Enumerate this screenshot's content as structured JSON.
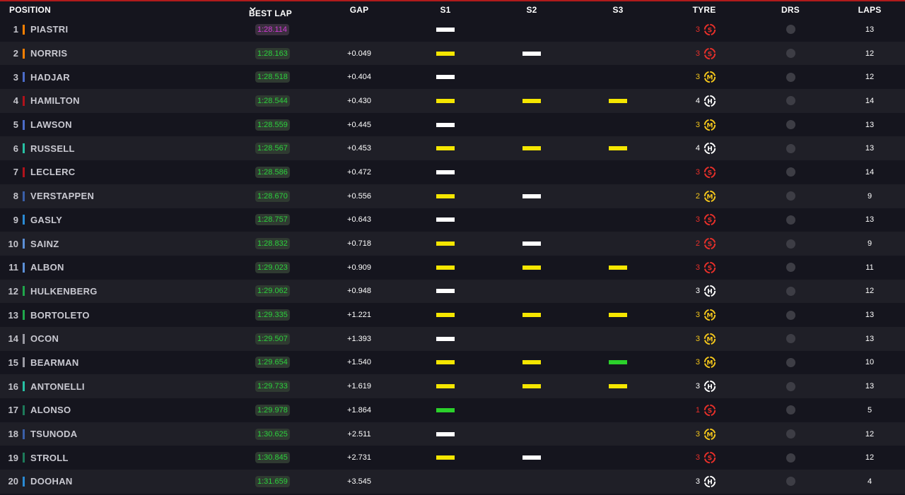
{
  "columns": {
    "position": "POSITION",
    "best_lap": "BEST LAP",
    "gap": "GAP",
    "s1": "S1",
    "s2": "S2",
    "s3": "S3",
    "tyre": "TYRE",
    "drs": "DRS",
    "laps": "LAPS"
  },
  "colors": {
    "white": "#ffffff",
    "yellow": "#f5e600",
    "green": "#2bd12b",
    "purple": "#d13bd6",
    "soft": "#e8302a",
    "medium": "#f4c61b",
    "hard": "#ffffff"
  },
  "tyre_letters": {
    "soft": "S",
    "medium": "M",
    "hard": "H"
  },
  "rows": [
    {
      "pos": "1",
      "driver": "PIASTRI",
      "team_color": "#ff8000",
      "best_lap": "1:28.114",
      "best_color": "purple",
      "gap": "",
      "s1": "white",
      "s2": "",
      "s3": "",
      "tyre": "soft",
      "tyre_age": "3",
      "laps": "13"
    },
    {
      "pos": "2",
      "driver": "NORRIS",
      "team_color": "#ff8000",
      "best_lap": "1:28.163",
      "best_color": "green",
      "gap": "+0.049",
      "s1": "yellow",
      "s2": "white",
      "s3": "",
      "tyre": "soft",
      "tyre_age": "3",
      "laps": "12"
    },
    {
      "pos": "3",
      "driver": "HADJAR",
      "team_color": "#4b6cc9",
      "best_lap": "1:28.518",
      "best_color": "green",
      "gap": "+0.404",
      "s1": "white",
      "s2": "",
      "s3": "",
      "tyre": "medium",
      "tyre_age": "3",
      "laps": "12"
    },
    {
      "pos": "4",
      "driver": "HAMILTON",
      "team_color": "#b0121b",
      "best_lap": "1:28.544",
      "best_color": "green",
      "gap": "+0.430",
      "s1": "yellow",
      "s2": "yellow",
      "s3": "yellow",
      "tyre": "hard",
      "tyre_age": "4",
      "laps": "14"
    },
    {
      "pos": "5",
      "driver": "LAWSON",
      "team_color": "#4b6cc9",
      "best_lap": "1:28.559",
      "best_color": "green",
      "gap": "+0.445",
      "s1": "white",
      "s2": "",
      "s3": "",
      "tyre": "medium",
      "tyre_age": "3",
      "laps": "13"
    },
    {
      "pos": "6",
      "driver": "RUSSELL",
      "team_color": "#27c1a4",
      "best_lap": "1:28.567",
      "best_color": "green",
      "gap": "+0.453",
      "s1": "yellow",
      "s2": "yellow",
      "s3": "yellow",
      "tyre": "hard",
      "tyre_age": "4",
      "laps": "13"
    },
    {
      "pos": "7",
      "driver": "LECLERC",
      "team_color": "#b0121b",
      "best_lap": "1:28.586",
      "best_color": "green",
      "gap": "+0.472",
      "s1": "white",
      "s2": "",
      "s3": "",
      "tyre": "soft",
      "tyre_age": "3",
      "laps": "14"
    },
    {
      "pos": "8",
      "driver": "VERSTAPPEN",
      "team_color": "#3a5fa8",
      "best_lap": "1:28.670",
      "best_color": "green",
      "gap": "+0.556",
      "s1": "yellow",
      "s2": "white",
      "s3": "",
      "tyre": "medium",
      "tyre_age": "2",
      "laps": "9"
    },
    {
      "pos": "9",
      "driver": "GASLY",
      "team_color": "#2a8ad4",
      "best_lap": "1:28.757",
      "best_color": "green",
      "gap": "+0.643",
      "s1": "white",
      "s2": "",
      "s3": "",
      "tyre": "soft",
      "tyre_age": "3",
      "laps": "13"
    },
    {
      "pos": "10",
      "driver": "SAINZ",
      "team_color": "#5b8fd6",
      "best_lap": "1:28.832",
      "best_color": "green",
      "gap": "+0.718",
      "s1": "yellow",
      "s2": "white",
      "s3": "",
      "tyre": "soft",
      "tyre_age": "2",
      "laps": "9"
    },
    {
      "pos": "11",
      "driver": "ALBON",
      "team_color": "#5b8fd6",
      "best_lap": "1:29.023",
      "best_color": "green",
      "gap": "+0.909",
      "s1": "yellow",
      "s2": "yellow",
      "s3": "yellow",
      "tyre": "soft",
      "tyre_age": "3",
      "laps": "11"
    },
    {
      "pos": "12",
      "driver": "HULKENBERG",
      "team_color": "#1fa74b",
      "best_lap": "1:29.062",
      "best_color": "green",
      "gap": "+0.948",
      "s1": "white",
      "s2": "",
      "s3": "",
      "tyre": "hard",
      "tyre_age": "3",
      "laps": "12"
    },
    {
      "pos": "13",
      "driver": "BORTOLETO",
      "team_color": "#1fa74b",
      "best_lap": "1:29.335",
      "best_color": "green",
      "gap": "+1.221",
      "s1": "yellow",
      "s2": "yellow",
      "s3": "yellow",
      "tyre": "medium",
      "tyre_age": "3",
      "laps": "13"
    },
    {
      "pos": "14",
      "driver": "OCON",
      "team_color": "#9a9aa3",
      "best_lap": "1:29.507",
      "best_color": "green",
      "gap": "+1.393",
      "s1": "white",
      "s2": "",
      "s3": "",
      "tyre": "medium",
      "tyre_age": "3",
      "laps": "13"
    },
    {
      "pos": "15",
      "driver": "BEARMAN",
      "team_color": "#9a9aa3",
      "best_lap": "1:29.654",
      "best_color": "green",
      "gap": "+1.540",
      "s1": "yellow",
      "s2": "yellow",
      "s3": "green",
      "tyre": "medium",
      "tyre_age": "3",
      "laps": "10"
    },
    {
      "pos": "16",
      "driver": "ANTONELLI",
      "team_color": "#27c1a4",
      "best_lap": "1:29.733",
      "best_color": "green",
      "gap": "+1.619",
      "s1": "yellow",
      "s2": "yellow",
      "s3": "yellow",
      "tyre": "hard",
      "tyre_age": "3",
      "laps": "13"
    },
    {
      "pos": "17",
      "driver": "ALONSO",
      "team_color": "#1d7a5a",
      "best_lap": "1:29.978",
      "best_color": "green",
      "gap": "+1.864",
      "s1": "green",
      "s2": "",
      "s3": "",
      "tyre": "soft",
      "tyre_age": "1",
      "laps": "5"
    },
    {
      "pos": "18",
      "driver": "TSUNODA",
      "team_color": "#3a5fa8",
      "best_lap": "1:30.625",
      "best_color": "green",
      "gap": "+2.511",
      "s1": "white",
      "s2": "",
      "s3": "",
      "tyre": "medium",
      "tyre_age": "3",
      "laps": "12"
    },
    {
      "pos": "19",
      "driver": "STROLL",
      "team_color": "#1d7a5a",
      "best_lap": "1:30.845",
      "best_color": "green",
      "gap": "+2.731",
      "s1": "yellow",
      "s2": "white",
      "s3": "",
      "tyre": "soft",
      "tyre_age": "3",
      "laps": "12"
    },
    {
      "pos": "20",
      "driver": "DOOHAN",
      "team_color": "#2a8ad4",
      "best_lap": "1:31.659",
      "best_color": "green",
      "gap": "+3.545",
      "s1": "",
      "s2": "",
      "s3": "",
      "tyre": "hard",
      "tyre_age": "3",
      "laps": "4"
    }
  ]
}
